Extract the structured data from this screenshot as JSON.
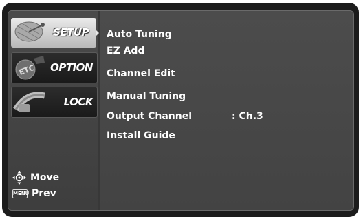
{
  "sidebar": {
    "tabs": [
      {
        "label": "SETUP",
        "selected": true
      },
      {
        "label": "OPTION",
        "selected": false
      },
      {
        "label": "LOCK",
        "selected": false
      }
    ],
    "hints": {
      "move_label": "Move",
      "prev_key": "MENU",
      "prev_label": "Prev"
    }
  },
  "menu": {
    "items": [
      {
        "label": "Auto Tuning"
      },
      {
        "label": "EZ Add"
      },
      {
        "label": "Channel Edit"
      },
      {
        "label": "Manual Tuning"
      },
      {
        "label": "Output Channel",
        "value": ": Ch.3"
      },
      {
        "label": "Install Guide"
      }
    ]
  },
  "icons": {
    "setup": "satellite-dish-icon",
    "option": "etc-icon",
    "lock": "lock-key-icon",
    "move": "directional-pad-icon",
    "menu": "menu-button-icon"
  },
  "colors": {
    "background": "#383838",
    "selected_tab": "#d0d0d0",
    "text": "#ffffff"
  }
}
